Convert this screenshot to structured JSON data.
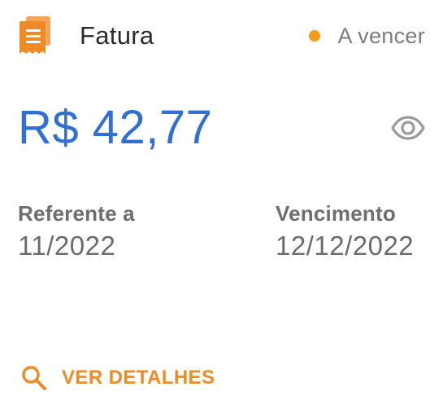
{
  "colors": {
    "accent": "#f08a24",
    "amount": "#2f6fd6",
    "status_dot": "#f59b1c",
    "eye": "#9a9a9a"
  },
  "header": {
    "icon": "receipt-icon",
    "title": "Fatura",
    "status": "A vencer"
  },
  "amount": {
    "value": "R$ 42,77",
    "visibility_icon": "eye-icon"
  },
  "info": {
    "reference_label": "Referente a",
    "reference_value": "11/2022",
    "due_label": "Vencimento",
    "due_value": "12/12/2022"
  },
  "details": {
    "icon": "search-icon",
    "label": "VER DETALHES"
  }
}
